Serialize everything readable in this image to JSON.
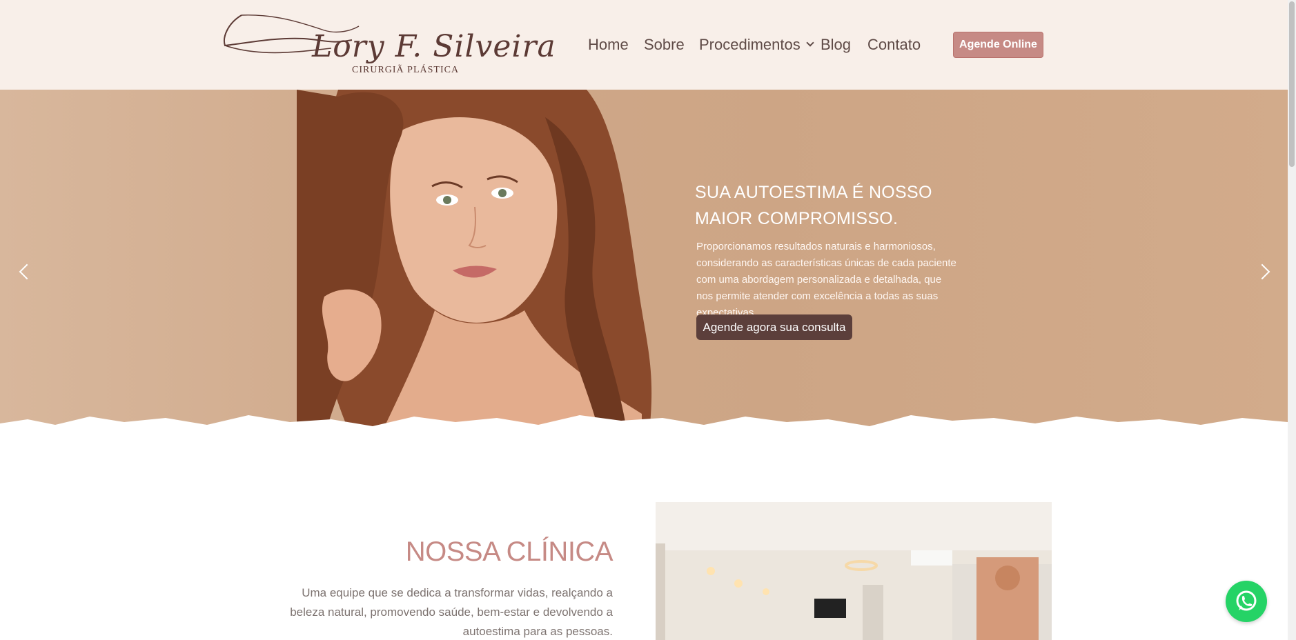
{
  "header": {
    "logo": {
      "name": "Lory F. Silveira",
      "subtitle": "CIRURGIÃ PLÁSTICA"
    },
    "nav": {
      "home": "Home",
      "sobre": "Sobre",
      "procedimentos": "Procedimentos",
      "blog": "Blog",
      "contato": "Contato"
    },
    "cta_label": "Agende Online"
  },
  "hero": {
    "title_line1": "SUA AUTOESTIMA É NOSSO",
    "title_line2": "MAIOR COMPROMISSO.",
    "text": "Proporcionamos resultados naturais e harmoniosos, considerando as características únicas de cada paciente com uma abordagem personalizada e detalhada, que nos permite atender com excelência a todas as suas expectativas.",
    "cta_label": "Agende agora sua consulta"
  },
  "clinic": {
    "title": "NOSSA CLÍNICA",
    "text": "Uma equipe que se dedica a transformar vidas, realçando a beleza natural, promovendo saúde, bem-estar e devolvendo a autoestima para as pessoas."
  },
  "icons": {
    "prev": "chevron-left-icon",
    "next": "chevron-right-icon",
    "dropdown": "chevron-down-icon",
    "whatsapp": "whatsapp-icon"
  },
  "colors": {
    "header_bg": "#f8efe9",
    "accent_pink": "#c68a85",
    "dark_brown": "#5c3f3b",
    "hero_bg": "#cfa889",
    "whatsapp_green": "#25d366"
  }
}
